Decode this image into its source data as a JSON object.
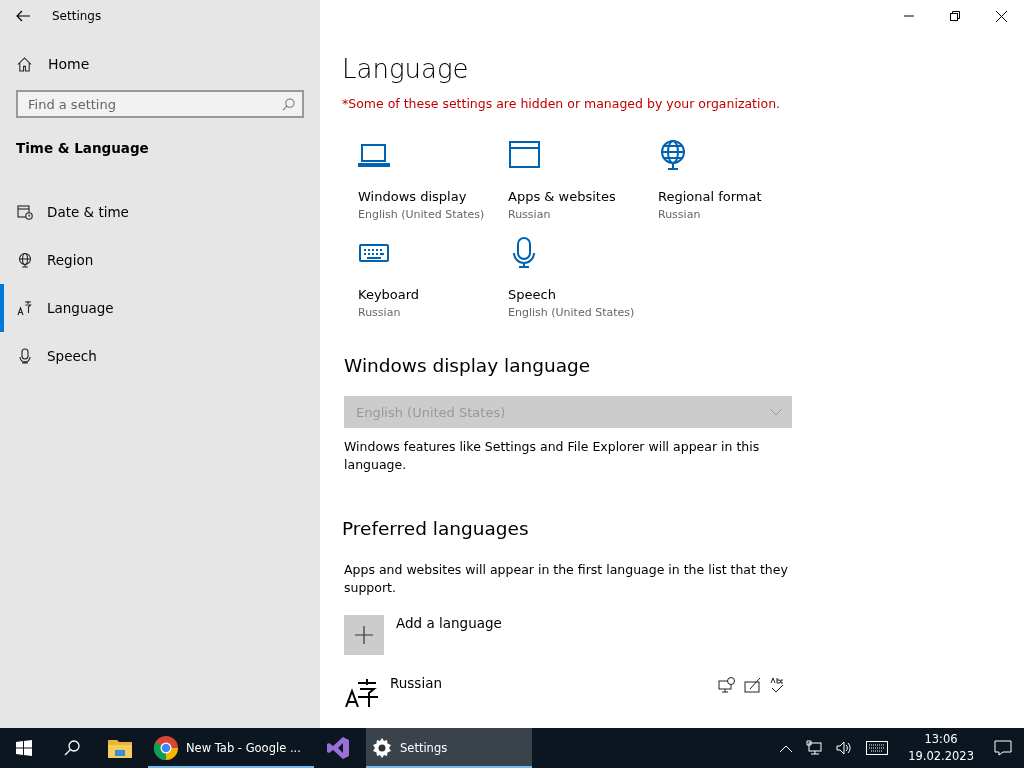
{
  "window": {
    "title": "Settings"
  },
  "sidebar": {
    "home": "Home",
    "search": {
      "placeholder": "Find a setting"
    },
    "section": "Time & Language",
    "items": [
      {
        "kind": "calendar",
        "label": "Date & time",
        "selected": false
      },
      {
        "kind": "globe",
        "label": "Region",
        "selected": false
      },
      {
        "kind": "language",
        "label": "Language",
        "selected": true
      },
      {
        "kind": "mic",
        "label": "Speech",
        "selected": false
      }
    ]
  },
  "page": {
    "title": "Language",
    "notice": "*Some of these settings are hidden or managed by your organization.",
    "tiles": [
      {
        "kind": "laptop",
        "label": "Windows display",
        "value": "English (United States)"
      },
      {
        "kind": "window",
        "label": "Apps & websites",
        "value": "Russian"
      },
      {
        "kind": "globe",
        "label": "Regional format",
        "value": "Russian"
      },
      {
        "kind": "keyboard",
        "label": "Keyboard",
        "value": "Russian"
      },
      {
        "kind": "mic",
        "label": "Speech",
        "value": "English (United States)"
      }
    ],
    "display_language": {
      "heading": "Windows display language",
      "dropdown": {
        "value": "English (United States)",
        "disabled": true
      },
      "description": "Windows features like Settings and File Explorer will appear in this language."
    },
    "preferred": {
      "heading": "Preferred languages",
      "description": "Apps and websites will appear in the first language in the list that they support.",
      "add_button": "Add a language",
      "languages": [
        {
          "name": "Russian"
        }
      ]
    }
  },
  "taskbar": {
    "apps": [
      {
        "kind": "explorer",
        "running": false,
        "selected": false
      },
      {
        "kind": "chrome",
        "label": "New Tab - Google ...",
        "running": true,
        "selected": false
      },
      {
        "kind": "studio",
        "running": false,
        "selected": false
      },
      {
        "kind": "gear",
        "label": "Settings",
        "running": true,
        "selected": true
      }
    ],
    "clock": {
      "time": "13:06",
      "date": "19.02.2023"
    }
  }
}
